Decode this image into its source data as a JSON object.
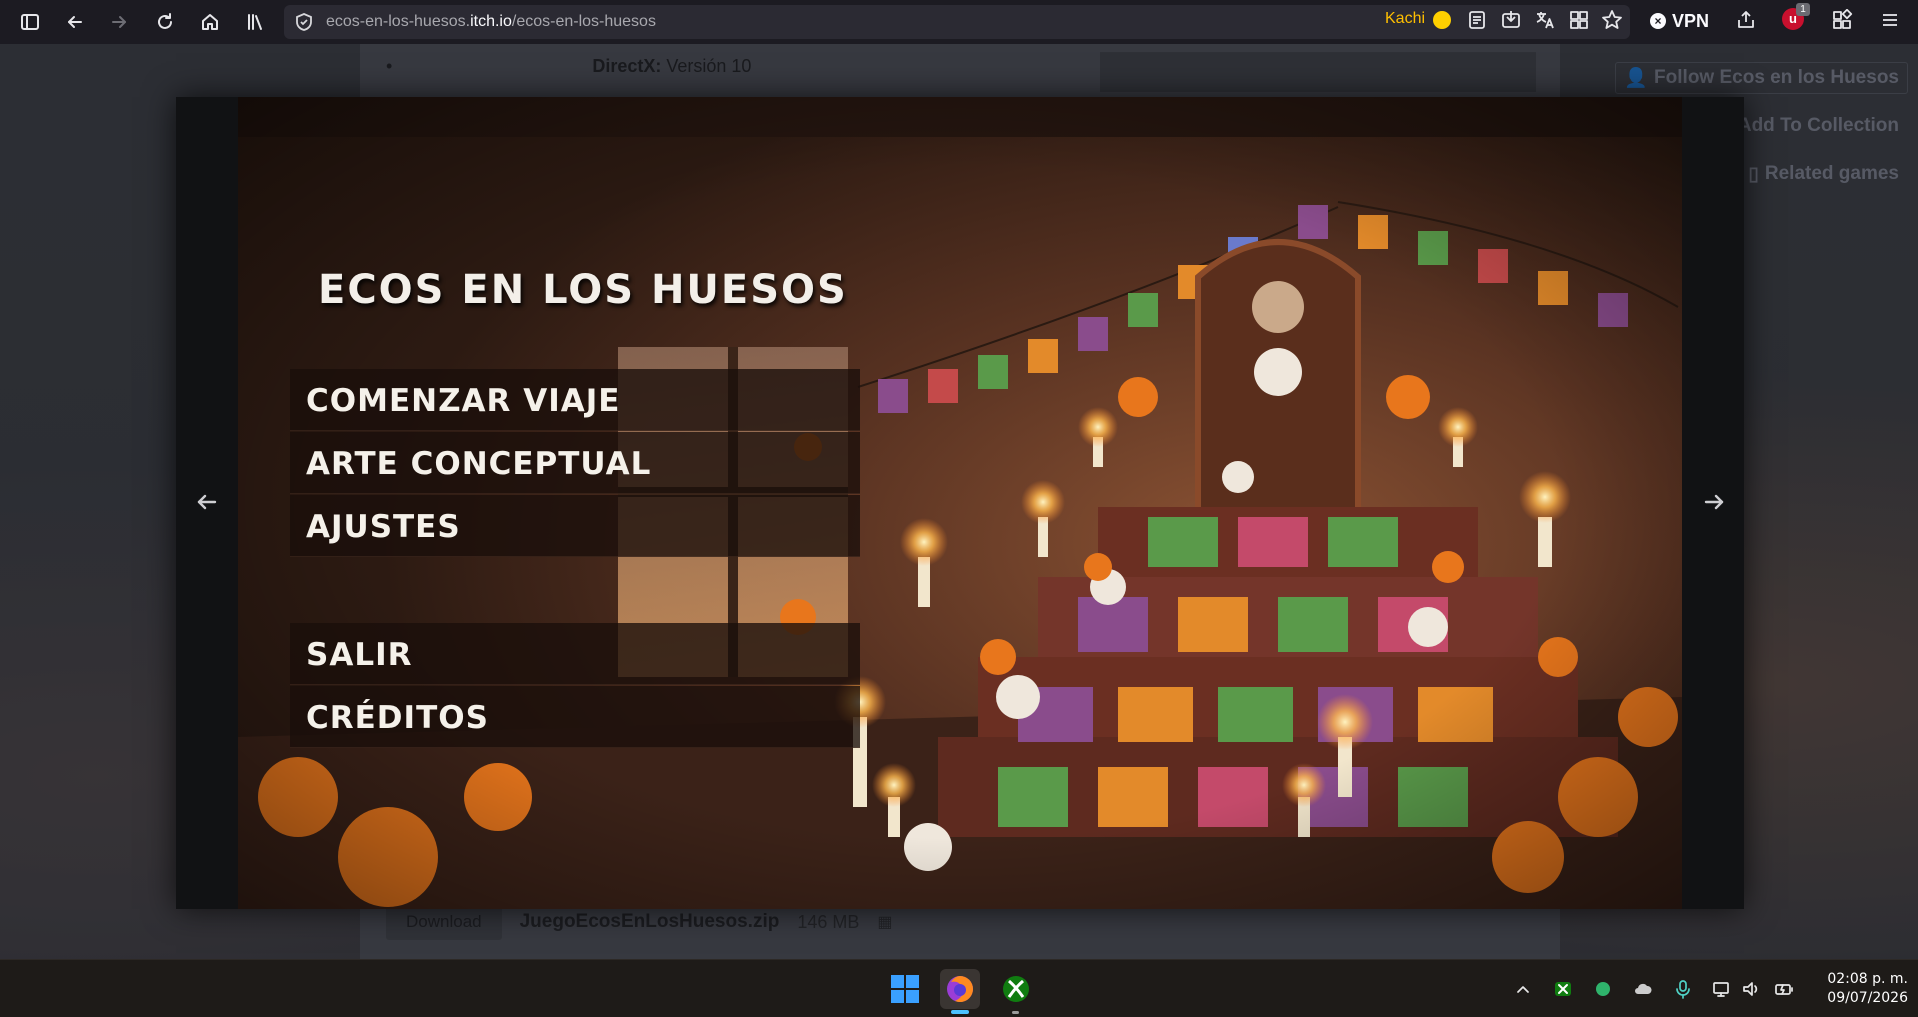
{
  "browser": {
    "url_prefix": "ecos-en-los-huesos.",
    "url_host": "itch.io",
    "url_path": "/ecos-en-los-huesos",
    "profile_label": "Kachi",
    "vpn_label": "VPN",
    "extension_badge_count": "1"
  },
  "background_page": {
    "directx_label": "DirectX:",
    "directx_value": " Versión 10",
    "follow_button": "Follow Ecos en los Huesos",
    "add_collection_button": "Add To Collection",
    "related_games_button": "Related games",
    "download_button": "Download",
    "download_filename": "JuegoEcosEnLosHuesos.zip",
    "download_size": "146 MB"
  },
  "game": {
    "title": "ECOS EN LOS HUESOS",
    "menu": [
      {
        "label": "COMENZAR VIAJE"
      },
      {
        "label": "ARTE CONCEPTUAL"
      },
      {
        "label": "AJUSTES"
      },
      {
        "label": "SALIR"
      },
      {
        "label": "CRÉDITOS"
      }
    ]
  },
  "taskbar": {
    "time": "02:08 p. m.",
    "date": "09/07/2026"
  },
  "colors": {
    "toolbar_bg": "#1c1b22",
    "urlbar_bg": "#2b2a33",
    "profile_accent": "#ffbf00",
    "marigold": "#e8761c",
    "taskbar_bg": "#1e1b18"
  },
  "icons": [
    "sidebar-icon",
    "back-icon",
    "forward-icon",
    "reload-icon",
    "home-icon",
    "library-icon",
    "shield-icon",
    "reader-icon",
    "save-pocket-icon",
    "translate-icon",
    "extensions-grid-icon",
    "bookmark-star-icon",
    "share-icon",
    "ublock-icon",
    "apps-grid-icon",
    "menu-icon",
    "arrow-left-icon",
    "arrow-right-icon",
    "windows-start-icon",
    "firefox-icon",
    "xbox-icon",
    "chevron-up-icon",
    "wifi-icon",
    "volume-icon",
    "battery-icon"
  ]
}
